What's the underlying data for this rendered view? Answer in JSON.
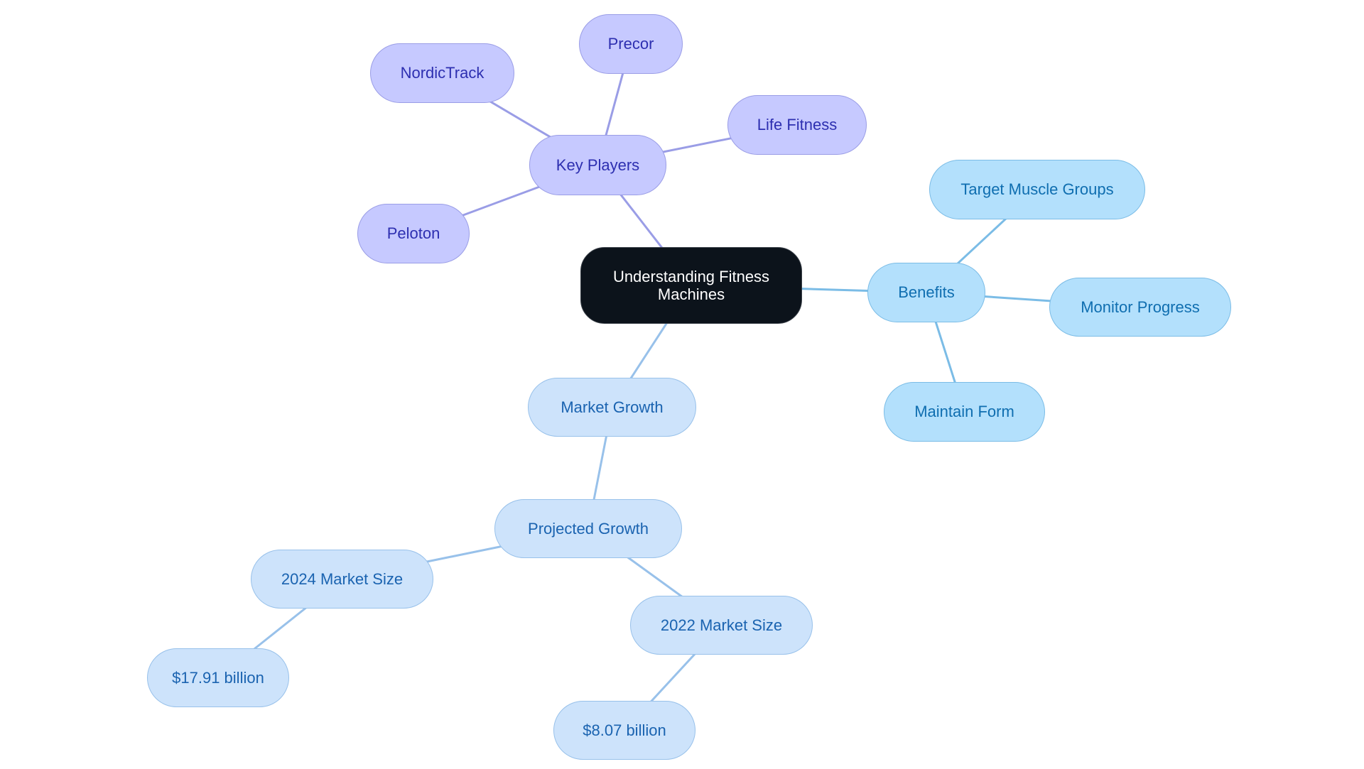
{
  "diagram": {
    "type": "mind-map",
    "colors": {
      "root_fill": "#0c131b",
      "root_text": "#ffffff",
      "key_players_fill": "#c6c9ff",
      "key_players_stroke": "#9a9de6",
      "key_players_text": "#2d2fb0",
      "benefits_fill": "#b3e0fc",
      "benefits_stroke": "#7bbce6",
      "benefits_text": "#0f6eb0",
      "market_fill": "#cde3fb",
      "market_stroke": "#98c1ea",
      "market_text": "#1a63b0"
    },
    "nodes": {
      "root": "Understanding Fitness Machines",
      "key_players": "Key Players",
      "nordictrack": "NordicTrack",
      "precor": "Precor",
      "life_fitness": "Life Fitness",
      "peloton": "Peloton",
      "benefits": "Benefits",
      "target_muscle_groups": "Target Muscle Groups",
      "monitor_progress": "Monitor Progress",
      "maintain_form": "Maintain Form",
      "market_growth": "Market Growth",
      "projected_growth": "Projected Growth",
      "market_size_2024": "2024 Market Size",
      "value_2024": "$17.91 billion",
      "market_size_2022": "2022 Market Size",
      "value_2022": "$8.07 billion"
    },
    "edges": [
      [
        "root",
        "key_players"
      ],
      [
        "key_players",
        "nordictrack"
      ],
      [
        "key_players",
        "precor"
      ],
      [
        "key_players",
        "life_fitness"
      ],
      [
        "key_players",
        "peloton"
      ],
      [
        "root",
        "benefits"
      ],
      [
        "benefits",
        "target_muscle_groups"
      ],
      [
        "benefits",
        "monitor_progress"
      ],
      [
        "benefits",
        "maintain_form"
      ],
      [
        "root",
        "market_growth"
      ],
      [
        "market_growth",
        "projected_growth"
      ],
      [
        "projected_growth",
        "market_size_2024"
      ],
      [
        "market_size_2024",
        "value_2024"
      ],
      [
        "projected_growth",
        "market_size_2022"
      ],
      [
        "market_size_2022",
        "value_2022"
      ]
    ]
  }
}
